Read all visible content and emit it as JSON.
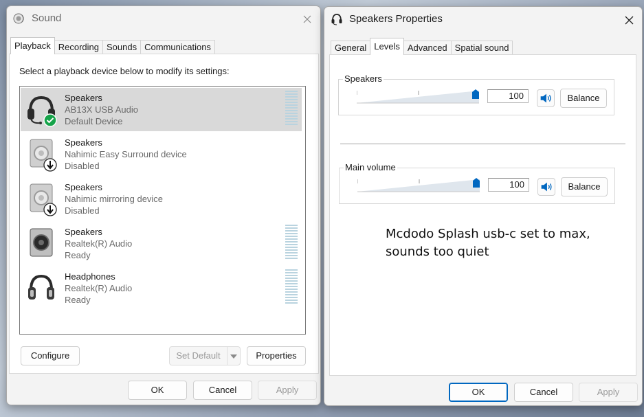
{
  "sound_window": {
    "title": "Sound",
    "tabs": [
      "Playback",
      "Recording",
      "Sounds",
      "Communications"
    ],
    "active_tab": "Playback",
    "instruction": "Select a playback device below to modify its settings:",
    "devices": [
      {
        "name": "Speakers",
        "description": "AB13X USB Audio",
        "status": "Default Device",
        "icon": "headset-icon",
        "badge": "check-badge-icon",
        "selected": true
      },
      {
        "name": "Speakers",
        "description": "Nahimic Easy Surround device",
        "status": "Disabled",
        "icon": "speaker-icon",
        "badge": "disabled-arrow-badge-icon",
        "selected": false
      },
      {
        "name": "Speakers",
        "description": "Nahimic mirroring device",
        "status": "Disabled",
        "icon": "speaker-icon",
        "badge": "disabled-arrow-badge-icon",
        "selected": false
      },
      {
        "name": "Speakers",
        "description": "Realtek(R) Audio",
        "status": "Ready",
        "icon": "speaker-icon",
        "badge": "",
        "selected": false
      },
      {
        "name": "Headphones",
        "description": "Realtek(R) Audio",
        "status": "Ready",
        "icon": "headphones-icon",
        "badge": "",
        "selected": false
      }
    ],
    "buttons": {
      "configure": "Configure",
      "set_default": "Set Default",
      "properties": "Properties",
      "ok": "OK",
      "cancel": "Cancel",
      "apply": "Apply"
    }
  },
  "properties_window": {
    "title": "Speakers Properties",
    "tabs": [
      "General",
      "Levels",
      "Advanced",
      "Spatial sound"
    ],
    "active_tab": "Levels",
    "levels": [
      {
        "label": "Speakers",
        "value": "100",
        "level_percent": 100,
        "balance_label": "Balance"
      },
      {
        "label": "Main volume",
        "value": "100",
        "level_percent": 100,
        "balance_label": "Balance"
      }
    ],
    "buttons": {
      "ok": "OK",
      "cancel": "Cancel",
      "apply": "Apply"
    }
  },
  "annotation": {
    "line1": "Mcdodo Splash usb-c set to max,",
    "line2": "sounds too quiet"
  },
  "colors": {
    "accent": "#0067c0",
    "check": "#16a34a",
    "meter": "#b9d3df"
  }
}
